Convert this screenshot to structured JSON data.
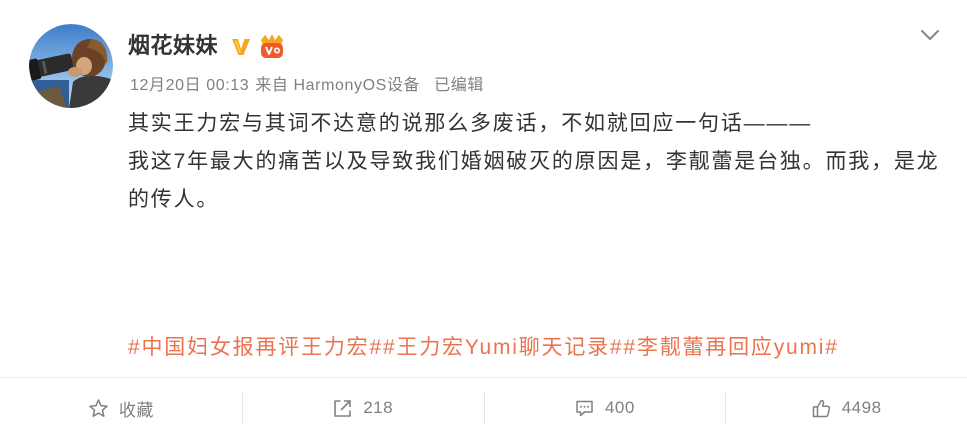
{
  "user": {
    "name": "烟花妹妹",
    "avatar_icon": "avatar-photo",
    "verified_icon": "verified-v-icon",
    "member_icon": "vip-member-icon"
  },
  "meta": {
    "datetime": "12月20日 00:13",
    "source": "来自 HarmonyOS设备",
    "edited": "已编辑"
  },
  "body": {
    "lines": [
      "其实王力宏与其词不达意的说那么多废话，不如就回应一句话———",
      "我这7年最大的痛苦以及导致我们婚姻破灭的原因是，李靓蕾是台独。而我，是龙",
      "的传人。"
    ]
  },
  "topics": [
    "#中国妇女报再评王力宏#",
    "#王力宏Yumi聊天记录#",
    "#李靓蕾再回应yumi#"
  ],
  "actions": [
    {
      "icon": "star-icon",
      "label": "收藏"
    },
    {
      "icon": "share-icon",
      "label": "218"
    },
    {
      "icon": "comment-icon",
      "label": "400"
    },
    {
      "icon": "like-icon",
      "label": "4498"
    }
  ],
  "menu_icon": "chevron-down-icon",
  "colors": {
    "text": "#333333",
    "muted": "#808080",
    "topic": "#eb7350",
    "divider": "#efefef",
    "verified": "#f6a623",
    "vip": "#f05a2a"
  }
}
